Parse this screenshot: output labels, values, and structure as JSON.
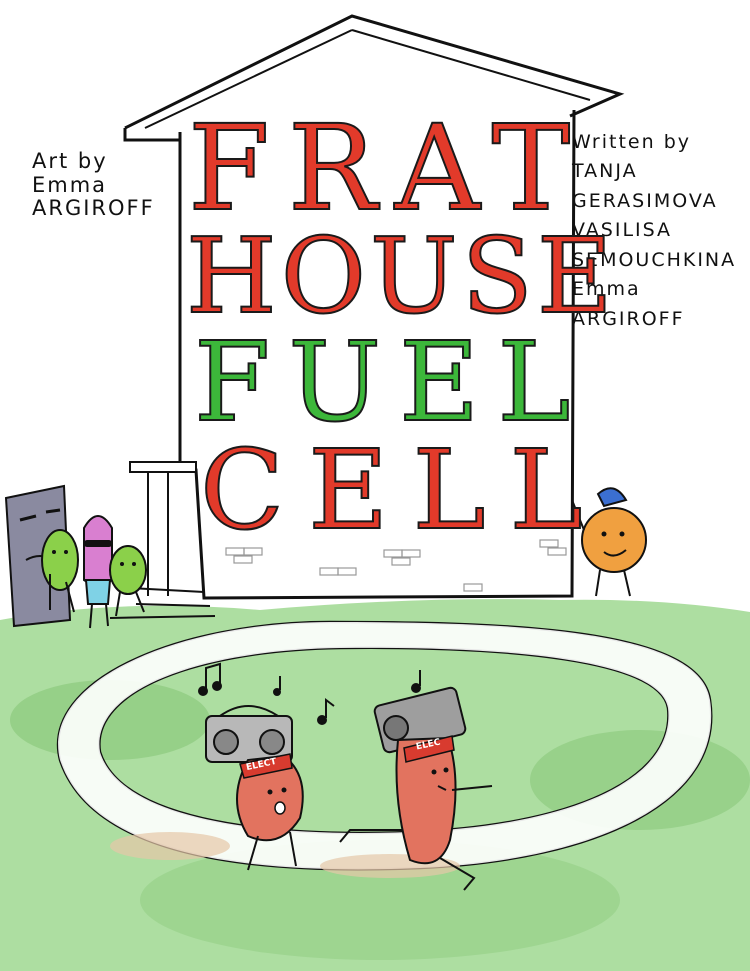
{
  "credits": {
    "art": [
      "Art by",
      "Emma",
      "ARGIROFF"
    ],
    "written": [
      "Written by",
      "TANJA",
      "GERASIMOVA",
      "VASILISA",
      "SEMOUCHKINA",
      "Emma",
      "ARGIROFF"
    ]
  },
  "title": {
    "line1": "FRAT",
    "line2": "HOUSE",
    "line3": "FUEL",
    "line4": "CELL"
  },
  "labels": {
    "left_runner_tag": "ELECT",
    "right_runner_tag": "ELEC"
  },
  "colors": {
    "title_red": "#e23a2a",
    "title_green": "#3cb73a",
    "grass": "#8fd07f",
    "runner_body": "#e2735f",
    "oxygen_body": "#f0a040"
  }
}
